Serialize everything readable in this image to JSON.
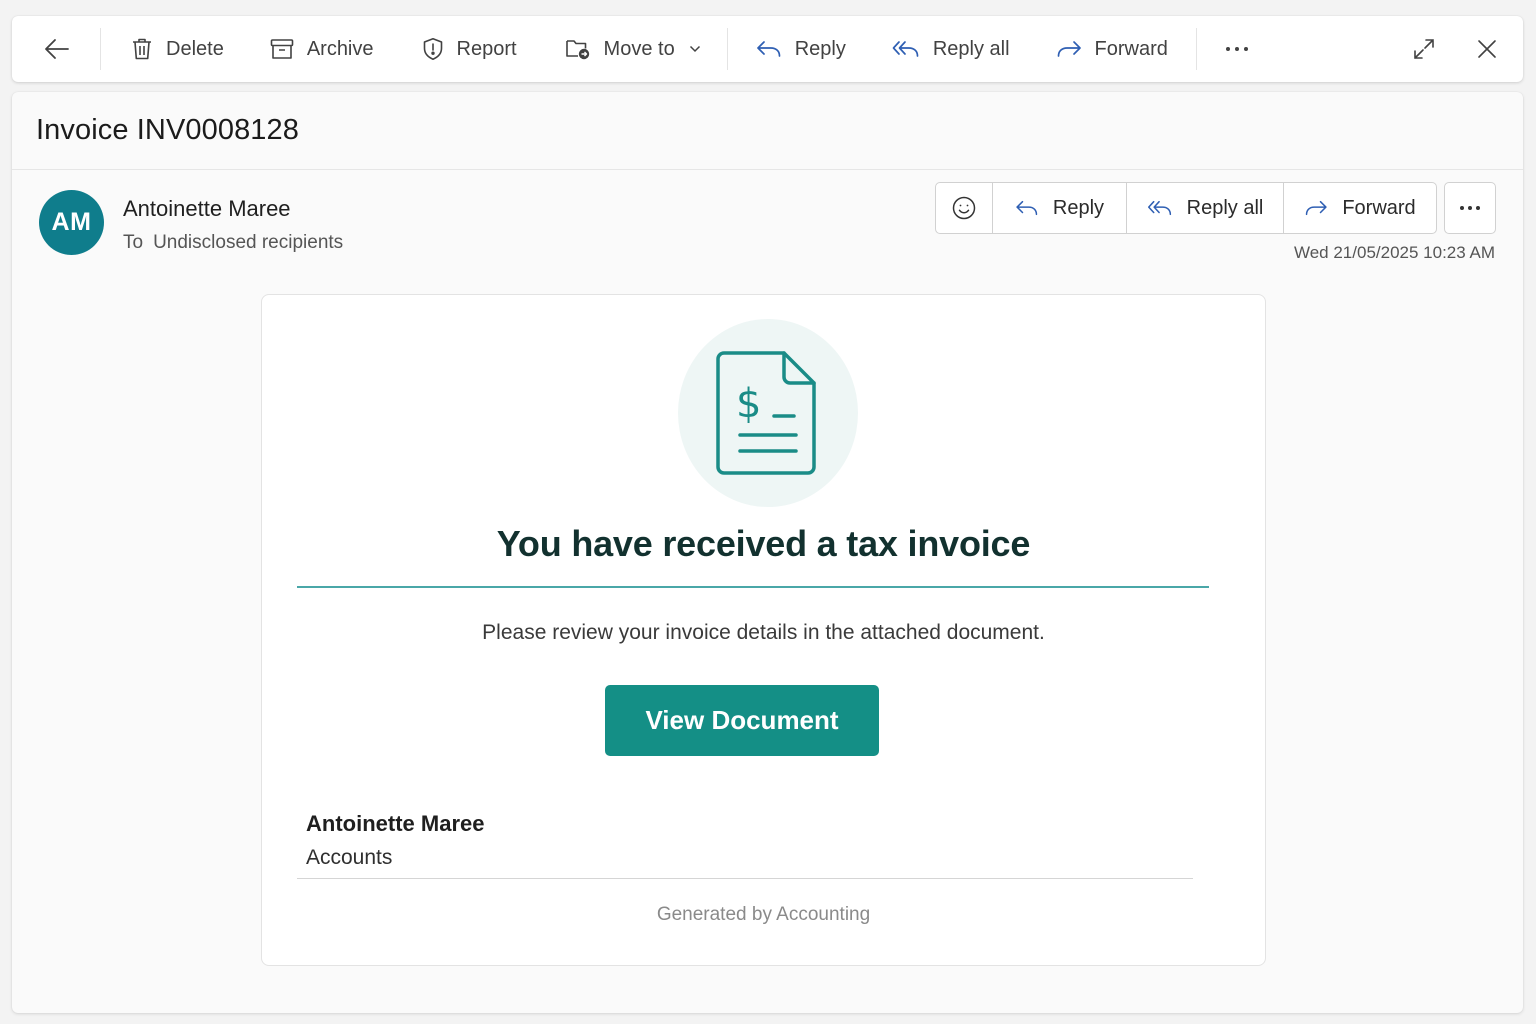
{
  "toolbar": {
    "delete_label": "Delete",
    "archive_label": "Archive",
    "report_label": "Report",
    "move_to_label": "Move to",
    "reply_label": "Reply",
    "reply_all_label": "Reply all",
    "forward_label": "Forward"
  },
  "message": {
    "subject": "Invoice INV0008128",
    "sender_initials": "AM",
    "sender_name": "Antoinette Maree",
    "to_prefix": "To",
    "recipients": "Undisclosed recipients",
    "date": "Wed 21/05/2025 10:23 AM"
  },
  "actions": {
    "reply_label": "Reply",
    "reply_all_label": "Reply all",
    "forward_label": "Forward"
  },
  "email_body": {
    "headline": "You have received a tax invoice",
    "text": "Please review your invoice details in the attached document.",
    "button_label": "View Document",
    "signature_name": "Antoinette Maree",
    "signature_department": "Accounts",
    "footer": "Generated by Accounting"
  },
  "icons": {
    "back": "arrow-left-icon",
    "delete": "trash-icon",
    "archive": "archive-box-icon",
    "report": "shield-icon",
    "move_to": "folder-move-icon",
    "reply": "reply-arrow-icon",
    "reply_all": "reply-all-arrow-icon",
    "forward": "forward-arrow-icon",
    "more": "more-dots-icon",
    "expand": "expand-icon",
    "close": "close-icon",
    "emoji": "smiley-icon",
    "document": "invoice-document-icon"
  },
  "colors": {
    "avatar": "#0f7d8c",
    "accent_teal": "#148f86",
    "icon_blue": "#2f5fb3",
    "divider_teal": "#4aa7a8"
  }
}
